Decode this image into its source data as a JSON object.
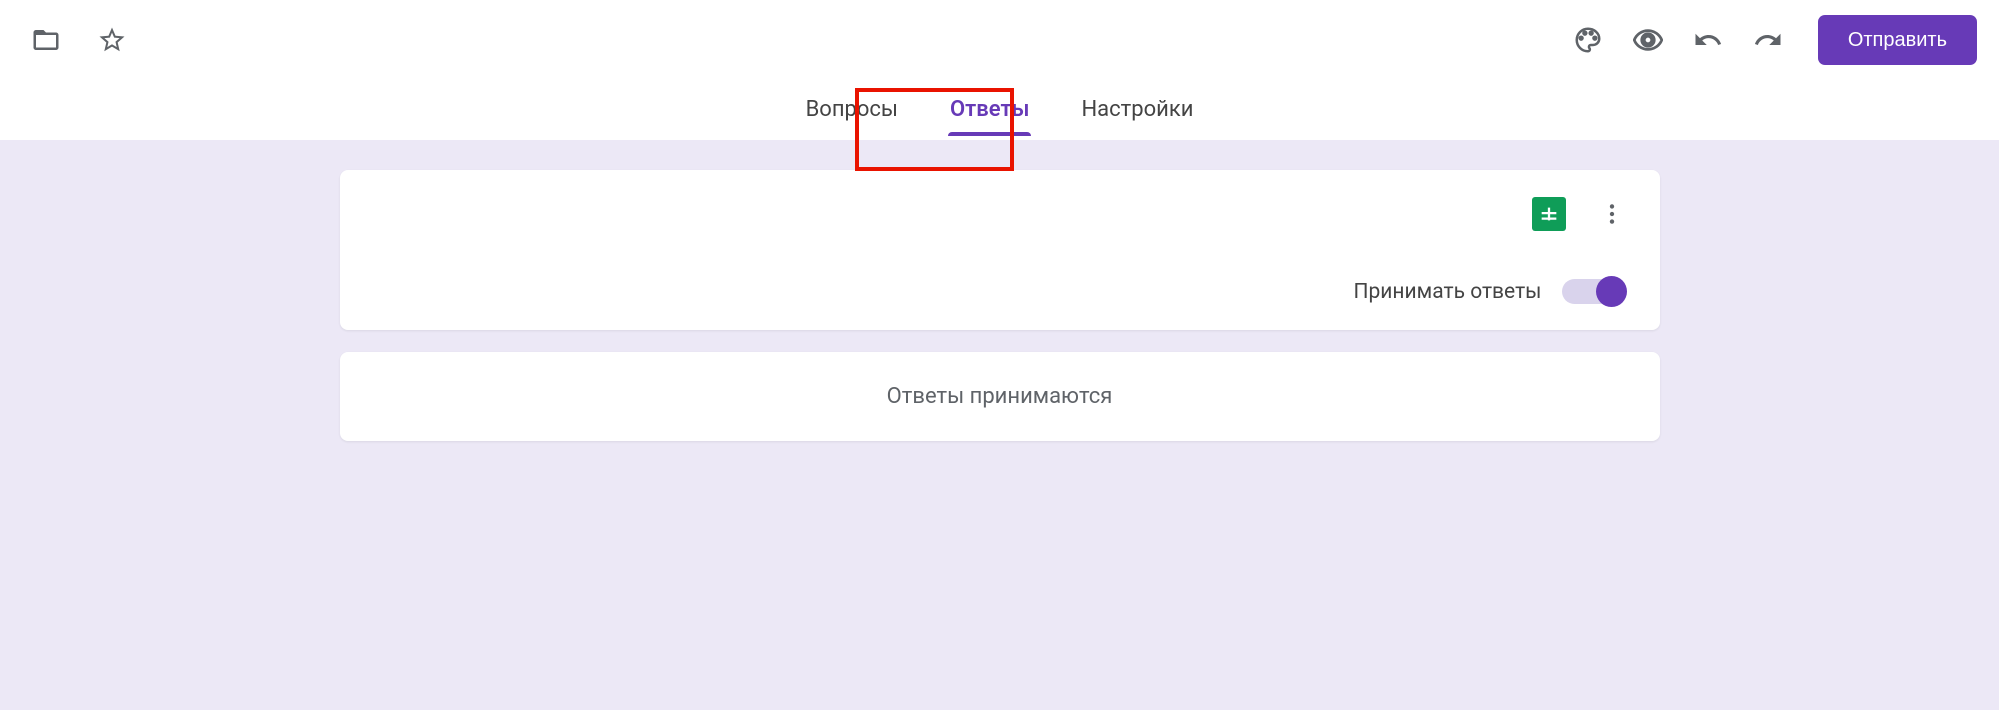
{
  "header": {
    "send_label": "Отправить"
  },
  "tabs": {
    "questions": "Вопросы",
    "responses": "Ответы",
    "settings": "Настройки"
  },
  "responses_panel": {
    "accept_label": "Принимать ответы",
    "accepting": true
  },
  "status_card": {
    "message": "Ответы принимаются"
  }
}
